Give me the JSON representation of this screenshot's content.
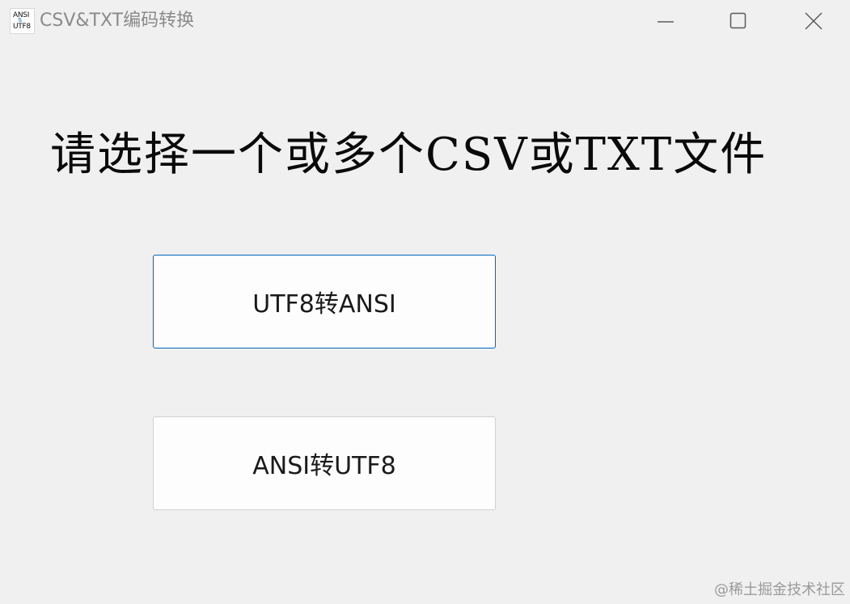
{
  "window": {
    "title": "CSV&TXT编码转换",
    "icon_text_top": "ANSI",
    "icon_text_bottom": "UTF8",
    "icon": "app-convert-icon"
  },
  "caption_buttons": {
    "minimize_icon": "minimize-icon",
    "maximize_icon": "maximize-icon",
    "close_icon": "close-icon"
  },
  "main": {
    "heading": "请选择一个或多个CSV或TXT文件",
    "buttons": [
      {
        "label": "UTF8转ANSI",
        "focused": true
      },
      {
        "label": "ANSI转UTF8",
        "focused": false
      }
    ]
  },
  "watermark": "@稀土掘金技术社区",
  "colors": {
    "background": "#f0f0f0",
    "title_text": "#8a8a8a",
    "focus_border": "#0067c0",
    "button_bg": "#fdfdfd"
  }
}
